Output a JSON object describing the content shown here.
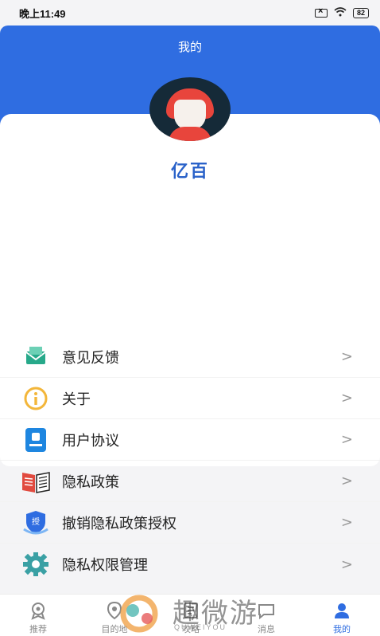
{
  "status_bar": {
    "time": "晚上11:49",
    "battery": "82"
  },
  "header": {
    "title": "我的"
  },
  "profile": {
    "username": "亿百"
  },
  "menu": {
    "items": [
      {
        "label": "意见反馈",
        "icon": "feedback-mail-icon"
      },
      {
        "label": "关于",
        "icon": "info-icon"
      },
      {
        "label": "用户协议",
        "icon": "user-agreement-icon"
      },
      {
        "label": "隐私政策",
        "icon": "privacy-book-icon"
      },
      {
        "label": "撤销隐私政策授权",
        "icon": "revoke-shield-icon"
      },
      {
        "label": "隐私权限管理",
        "icon": "settings-gear-icon"
      }
    ],
    "arrow": ">"
  },
  "bottom_nav": {
    "items": [
      {
        "label": "推荐",
        "icon": "recommend-icon",
        "active": false
      },
      {
        "label": "目的地",
        "icon": "location-icon",
        "active": false
      },
      {
        "label": "攻略",
        "icon": "guide-icon",
        "active": false
      },
      {
        "label": "消息",
        "icon": "message-icon",
        "active": false
      },
      {
        "label": "我的",
        "icon": "profile-icon",
        "active": true
      }
    ]
  },
  "watermark": {
    "text": "趣微游",
    "sub": "QUWEIYOU"
  },
  "colors": {
    "primary": "#2f6de1",
    "username": "#2a62c9",
    "avatar_bg": "#152a38",
    "avatar_hair": "#e8453c"
  }
}
